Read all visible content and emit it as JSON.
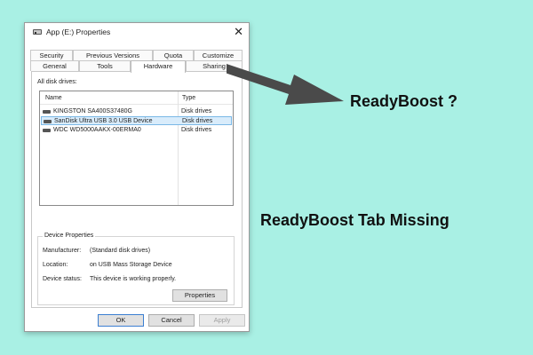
{
  "window": {
    "title": "App (E:) Properties",
    "close_glyph": "✕"
  },
  "tabs": {
    "row1": [
      "Security",
      "Previous Versions",
      "Quota",
      "Customize"
    ],
    "row2": [
      "General",
      "Tools",
      "Hardware",
      "Sharing"
    ],
    "active": "Hardware"
  },
  "hardware": {
    "list_label": "All disk drives:",
    "columns": {
      "name": "Name",
      "type": "Type"
    },
    "drives": [
      {
        "name": "KINGSTON SA400S37480G",
        "type": "Disk drives"
      },
      {
        "name": "SanDisk Ultra USB 3.0 USB Device",
        "type": "Disk drives"
      },
      {
        "name": "WDC WD5000AAKX-00ERMA0",
        "type": "Disk drives"
      }
    ],
    "selected_index": 1,
    "properties_group": {
      "title": "Device Properties",
      "manufacturer_label": "Manufacturer:",
      "manufacturer_value": "(Standard disk drives)",
      "location_label": "Location:",
      "location_value": "on USB Mass Storage Device",
      "status_label": "Device status:",
      "status_value": "This device is working properly.",
      "button": "Properties"
    }
  },
  "buttons": {
    "ok": "OK",
    "cancel": "Cancel",
    "apply": "Apply"
  },
  "overlay": {
    "question": "ReadyBoost ?",
    "headline": "ReadyBoost Tab Missing",
    "arrow_color": "#4a4a4a",
    "background_color": "#a9f0e4"
  }
}
